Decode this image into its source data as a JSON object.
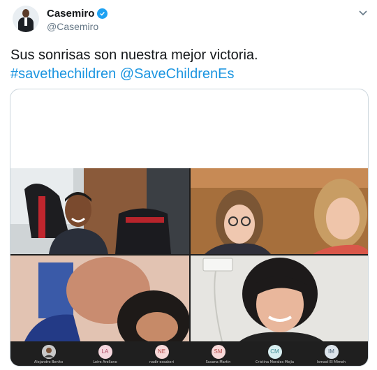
{
  "tweet": {
    "display_name": "Casemiro",
    "handle": "@Casemiro",
    "text_plain": "Sus sonrisas son nuestra mejor victoria.",
    "hashtag": "#savethechildren",
    "mention": "@SaveChildrenEs"
  },
  "participants": [
    {
      "initials": "",
      "name": "Alejandro Benito",
      "color": "#d6d6d6"
    },
    {
      "initials": "LA",
      "name": "Leire Arellano",
      "color": "#f6d7de"
    },
    {
      "initials": "NE",
      "name": "nadir essakeri",
      "color": "#f8d9d9"
    },
    {
      "initials": "SM",
      "name": "Susana Martin",
      "color": "#f8d9d9"
    },
    {
      "initials": "CM",
      "name": "Cristina Morales Mejia",
      "color": "#d7eef0"
    },
    {
      "initials": "IM",
      "name": "Ismael El Mimeh",
      "color": "#dde5ec"
    }
  ]
}
